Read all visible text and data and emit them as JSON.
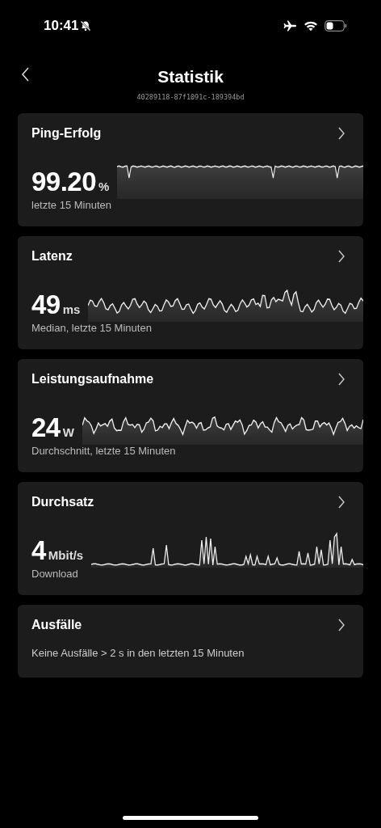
{
  "status_bar": {
    "time": "10:41"
  },
  "header": {
    "title": "Statistik",
    "subtitle": "40289118-87f1091c-189394bd"
  },
  "cards": [
    {
      "kind": "metric",
      "title": "Ping-Erfolg",
      "value": "99.20",
      "unit": "%",
      "caption": "letzte 15 Minuten"
    },
    {
      "kind": "metric",
      "title": "Latenz",
      "value": "49",
      "unit": "ms",
      "caption": "Median, letzte 15 Minuten"
    },
    {
      "kind": "metric",
      "title": "Leistungsaufnahme",
      "value": "24",
      "unit": "W",
      "caption": "Durchschnitt, letzte 15 Minuten"
    },
    {
      "kind": "metric",
      "title": "Durchsatz",
      "value": "4",
      "unit": "Mbit/s",
      "caption": "Download"
    },
    {
      "kind": "text",
      "title": "Ausfälle",
      "caption": "Keine Ausfälle > 2 s in den letzten 15 Minuten"
    }
  ]
}
